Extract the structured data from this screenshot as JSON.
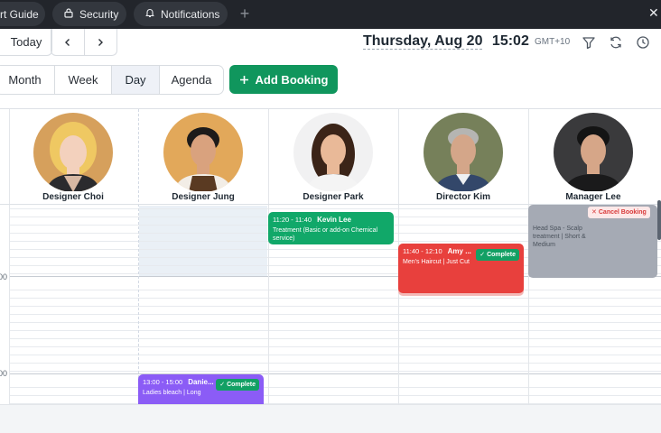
{
  "tabs": {
    "guide": "rt Guide",
    "security": "Security",
    "notifications": "Notifications",
    "add_icon": "plus-icon",
    "close_icon": "close-icon"
  },
  "toolbar": {
    "today": "Today",
    "prev_icon": "chevron-left-icon",
    "next_icon": "chevron-right-icon",
    "date": "Thursday, Aug 20",
    "time": "15:02",
    "timezone": "GMT+10",
    "icons": [
      "filter-icon",
      "refresh-icon",
      "clock-icon"
    ]
  },
  "views": {
    "month": "Month",
    "week": "Week",
    "day": "Day",
    "agenda": "Agenda",
    "active": "Day"
  },
  "add_booking": "Add Booking",
  "time_labels": [
    "00",
    "00"
  ],
  "staff": [
    {
      "name": "Designer Choi"
    },
    {
      "name": "Designer Jung"
    },
    {
      "name": "Designer Park"
    },
    {
      "name": "Director Kim"
    },
    {
      "name": "Manager Lee"
    }
  ],
  "events": {
    "kevin": {
      "time": "11:20 - 11:40",
      "customer": "Kevin Lee",
      "desc": "Treatment (Basic or add-on Chemical service)",
      "color": "#11a869"
    },
    "amy": {
      "time": "11:40 - 12:10",
      "customer": "Amy ...",
      "desc": "Men's Haircut | Just Cut",
      "status": "Complete",
      "color": "#e8403d"
    },
    "lee": {
      "desc": "Head Spa - Scalp treatment | Short & Medium",
      "action": "Cancel Booking",
      "color": "#a5aab4"
    },
    "daniel": {
      "time": "13:00 - 15:00",
      "customer": "Danie...",
      "desc": "Ladies bleach | Long",
      "status": "Complete",
      "color": "#8b5cf6"
    }
  },
  "colors": {
    "accent_green": "#10965d",
    "tab_bar": "#22252b"
  }
}
